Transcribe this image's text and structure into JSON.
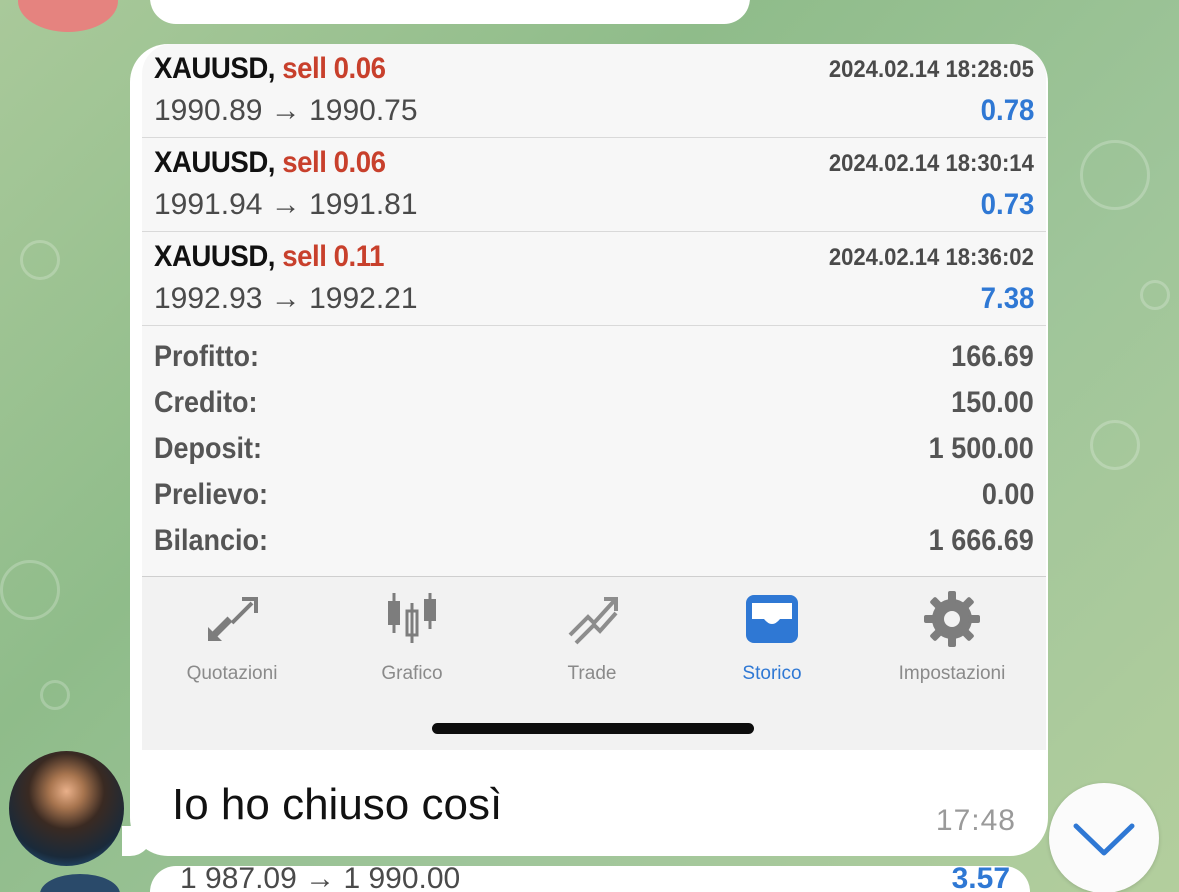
{
  "deals": [
    {
      "symbol": "XAUUSD,",
      "side": "sell 0.06",
      "time": "2024.02.14 18:28:05",
      "prices": "1990.89 → 1990.75",
      "profit": "0.78"
    },
    {
      "symbol": "XAUUSD,",
      "side": "sell 0.06",
      "time": "2024.02.14 18:30:14",
      "prices": "1991.94 → 1991.81",
      "profit": "0.73"
    },
    {
      "symbol": "XAUUSD,",
      "side": "sell 0.11",
      "time": "2024.02.14 18:36:02",
      "prices": "1992.93 → 1992.21",
      "profit": "7.38"
    }
  ],
  "summary": [
    {
      "label": "Profitto:",
      "value": "166.69"
    },
    {
      "label": "Credito:",
      "value": "150.00"
    },
    {
      "label": "Deposit:",
      "value": "1 500.00"
    },
    {
      "label": "Prelievo:",
      "value": "0.00"
    },
    {
      "label": "Bilancio:",
      "value": "1 666.69"
    }
  ],
  "tabs": [
    {
      "label": "Quotazioni",
      "icon": "quotes-arrows-icon",
      "active": false
    },
    {
      "label": "Grafico",
      "icon": "candlestick-chart-icon",
      "active": false
    },
    {
      "label": "Trade",
      "icon": "trade-trend-icon",
      "active": false
    },
    {
      "label": "Storico",
      "icon": "history-tray-icon",
      "active": true
    },
    {
      "label": "Impostazioni",
      "icon": "gear-icon",
      "active": false
    }
  ],
  "message": {
    "text": "Io ho chiuso così",
    "time": "17:48"
  },
  "next_message_partial": {
    "prices": "1 987.09 → 1 990.00",
    "profit": "3.57"
  },
  "colors": {
    "sell": "#c8402c",
    "profit": "#2f78d4",
    "active_tab": "#2f78d4",
    "inactive_tab": "#8a8a8a"
  }
}
